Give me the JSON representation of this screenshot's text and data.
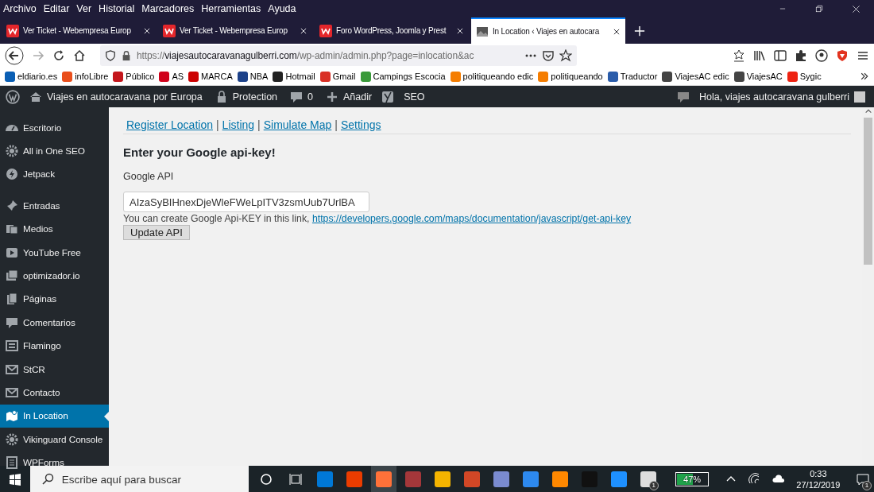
{
  "menu_bar": [
    "Archivo",
    "Editar",
    "Ver",
    "Historial",
    "Marcadores",
    "Herramientas",
    "Ayuda"
  ],
  "tabs": [
    {
      "title": "Ver Ticket - Webempresa Europ",
      "selected": false
    },
    {
      "title": "Ver Ticket - Webempresa Europ",
      "selected": false
    },
    {
      "title": "Foro WordPress, Joomla y Prest",
      "selected": false
    },
    {
      "title": "In Location ‹ Viajes en autocara",
      "selected": true
    }
  ],
  "address": {
    "scheme": "https://",
    "domain": "viajesautocaravanagulberri.com",
    "path": "/wp-admin/admin.php?page=inlocation&ac"
  },
  "bookmarks": [
    "eldiario.es",
    "infoLibre",
    "Público",
    "AS",
    "MARCA",
    "NBA",
    "Hotmail",
    "Gmail",
    "Campings Escocia",
    "politiqueando edic",
    "politiqueando",
    "Traductor",
    "ViajesAC edic",
    "ViajesAC",
    "Sygic"
  ],
  "admin_bar": {
    "site": "Viajes en autocaravana por Europa",
    "protection": "Protection",
    "comments": "0",
    "add": "Añadir",
    "seo": "SEO",
    "greeting": "Hola, viajes autocaravana gulberri"
  },
  "sidebar": {
    "items": [
      {
        "label": "Escritorio",
        "selected": false
      },
      {
        "label": "All in One SEO",
        "selected": false
      },
      {
        "label": "Jetpack",
        "selected": false
      },
      {
        "label": "Entradas",
        "selected": false
      },
      {
        "label": "Medios",
        "selected": false
      },
      {
        "label": "YouTube Free",
        "selected": false
      },
      {
        "label": "optimizador.io",
        "selected": false
      },
      {
        "label": "Páginas",
        "selected": false
      },
      {
        "label": "Comentarios",
        "selected": false
      },
      {
        "label": "Flamingo",
        "selected": false
      },
      {
        "label": "StCR",
        "selected": false
      },
      {
        "label": "Contacto",
        "selected": false
      },
      {
        "label": "In Location",
        "selected": true
      },
      {
        "label": "Vikinguard Console",
        "selected": false
      },
      {
        "label": "WPForms",
        "selected": false
      }
    ]
  },
  "nav_links": [
    "Register Location",
    "Listing",
    "Simulate Map",
    "Settings"
  ],
  "nav_separator": "|",
  "heading": "Enter your Google api-key!",
  "field": {
    "label": "Google API",
    "value": "AIzaSyBIHnexDjeWleFWeLpITV3zsmUub7UrlBA"
  },
  "help": {
    "text": "You can create Google Api-KEY in this link, ",
    "link": "https://developers.google.com/maps/documentation/javascript/get-api-key"
  },
  "button": "Update API",
  "taskbar": {
    "search_placeholder": "Escribe aquí para buscar",
    "mail_badge": "1",
    "battery": {
      "reading": "47%",
      "level": 0.47
    },
    "time": "0:33",
    "date": "27/12/2019",
    "notification_badge": "1"
  }
}
